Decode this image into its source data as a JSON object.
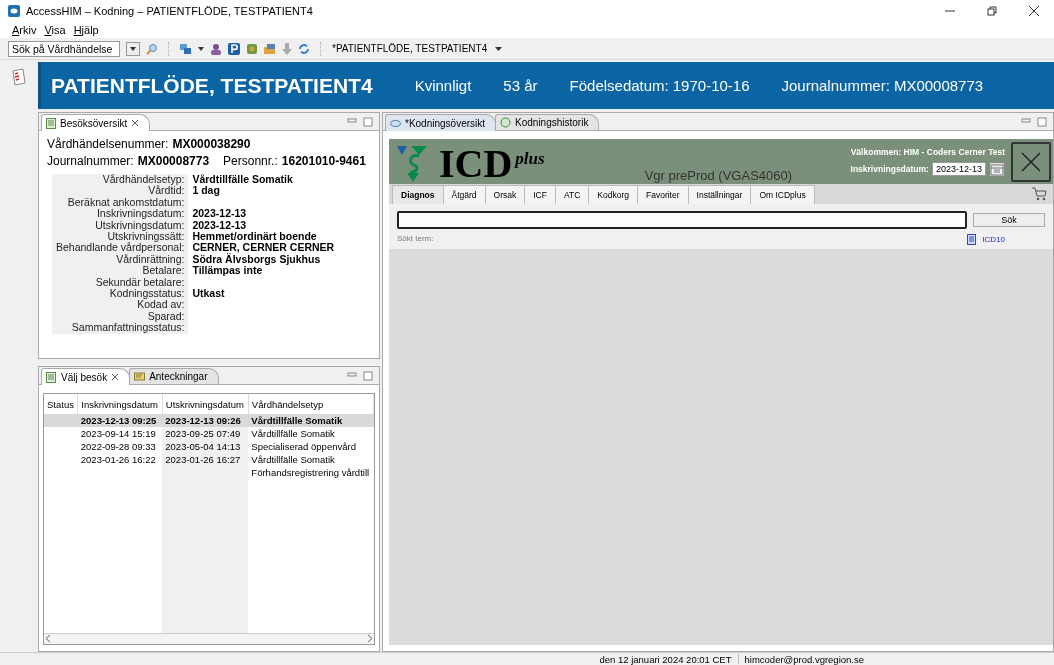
{
  "window": {
    "title": "AccessHIM – Kodning – PATIENTFLÖDE, TESTPATIENT4"
  },
  "menu": [
    "Arkiv",
    "Visa",
    "Hjälp"
  ],
  "toolbar": {
    "search_placeholder": "Sök på Vårdhändelse",
    "patient_selector": "*PATIENTFLÖDE, TESTPATIENT4"
  },
  "banner": {
    "name": "PATIENTFLÖDE, TESTPATIENT4",
    "gender": "Kvinnligt",
    "age": "53 år",
    "birth_date_label": "Födelsedatum:",
    "birth_date": "1970-10-16",
    "journal_label": "Journalnummer:",
    "journal": "MX00008773"
  },
  "visit_overview": {
    "tab": "Besöksöversikt",
    "header_lines": [
      [
        {
          "label": "Vårdhändelsenummer:",
          "value": "MX000038290"
        }
      ],
      [
        {
          "label": "Journalnummer:",
          "value": "MX00008773"
        },
        {
          "label": "Personnr.:",
          "value": "16201010-9461"
        }
      ]
    ],
    "fields": [
      {
        "label": "Vårdhändelsetyp:",
        "value": "Vårdtillfälle Somatik"
      },
      {
        "label": "Vårdtid:",
        "value": "1 dag"
      },
      {
        "label": "Beräknat ankomstdatum:"
      },
      {
        "label": "Inskrivningsdatum:",
        "value": "2023-12-13"
      },
      {
        "label": "Utskrivningsdatum:",
        "value": "2023-12-13"
      },
      {
        "label": "Utskrivningssätt:",
        "value": "Hemmet/ordinärt boende"
      },
      {
        "label": "Behandlande vårdpersonal:",
        "value": "CERNER, CERNER CERNER"
      },
      {
        "label": "Vårdinrättning:",
        "value": "Södra Älvsborgs Sjukhus"
      },
      {
        "label": "Betalare:",
        "value": "Tillämpas inte"
      },
      {
        "label": "Sekundär betalare:"
      },
      {
        "label": "Kodningsstatus:",
        "value": "Utkast"
      },
      {
        "label": "Kodad av:"
      },
      {
        "label": "Sparad:"
      },
      {
        "label": "Sammanfattningsstatus:"
      }
    ]
  },
  "visit_list": {
    "tabs": [
      {
        "label": "Välj besök",
        "selected": true
      },
      {
        "label": "Anteckningar",
        "selected": false
      }
    ],
    "columns": [
      "Status",
      "Inskrivningsdatum",
      "Utskrivningsdatum",
      "Vårdhändelsetyp"
    ],
    "rows": [
      {
        "selected": true,
        "admitted": "2023-12-13 09:25",
        "discharged": "2023-12-13 09:26",
        "type": "Vårdtillfälle Somatik"
      },
      {
        "selected": false,
        "admitted": "2023-09-14 15:19",
        "discharged": "2023-09-25 07:49",
        "type": "Vårdtillfälle Somatik"
      },
      {
        "selected": false,
        "admitted": "2022-09-28 09:33",
        "discharged": "2023-05-04 14:13",
        "type": "Specialiserad öppenvård"
      },
      {
        "selected": false,
        "admitted": "2023-01-26 16:22",
        "discharged": "2023-01-26 16:27",
        "type": "Vårdtillfälle Somatik"
      },
      {
        "selected": false,
        "type": "Förhandsregistrering vårdtill"
      }
    ]
  },
  "coding_tabs": [
    {
      "label": "*Kodningsöversikt",
      "selected": true
    },
    {
      "label": "Kodningshistorik",
      "selected": false
    }
  ],
  "icdplus": {
    "logo_text": "ICD",
    "logo_sup": "plus",
    "environment": "Vgr preProd (VGAS4060)",
    "welcome": "Välkommen: HIM - Coders Cerner Test",
    "date_label": "Inskrivningsdatum:",
    "date": "2023-12-13",
    "tabs": [
      {
        "label": "Diagnos",
        "selected": true
      },
      {
        "label": "Åtgärd",
        "selected": false
      },
      {
        "label": "Orsak",
        "selected": false
      },
      {
        "label": "ICF",
        "selected": false
      },
      {
        "label": "ATC",
        "selected": false
      },
      {
        "label": "Kodkorg",
        "selected": false
      },
      {
        "label": "Favoriter",
        "selected": false
      },
      {
        "label": "Inställningar",
        "selected": false
      },
      {
        "label": "Om ICDplus",
        "selected": false
      }
    ],
    "search_button": "Sök",
    "searched_term_label": "Sökt term:",
    "source_link": "ICD10"
  },
  "status_bar": [
    "den 12 januari 2024 20:01 CET",
    "himcoder@prod.vgregion.se"
  ]
}
